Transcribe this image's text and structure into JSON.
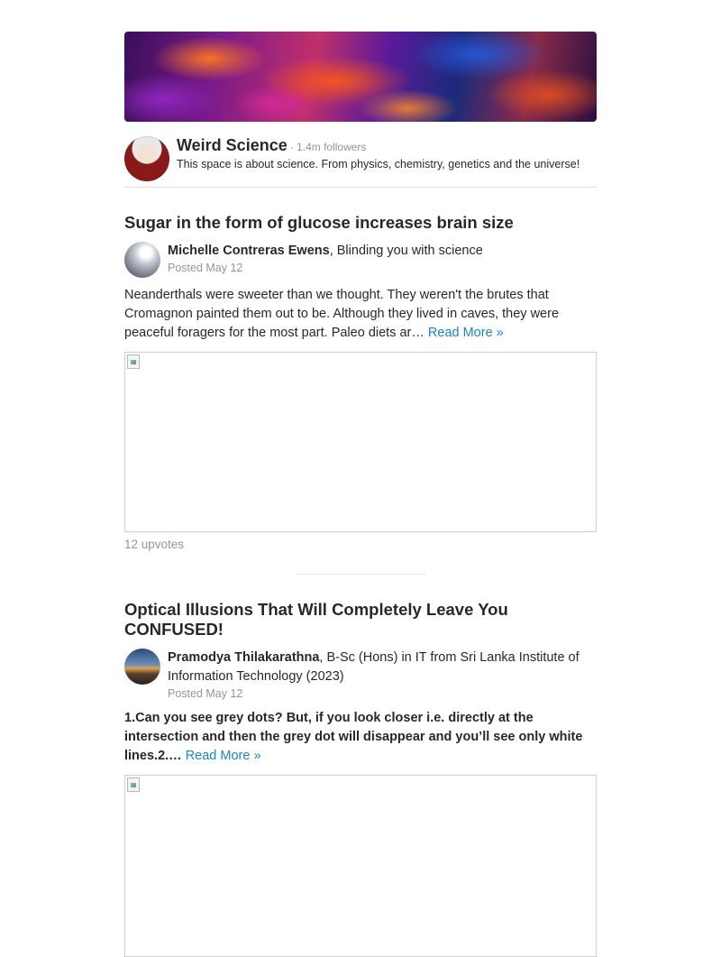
{
  "space": {
    "name": "Weird Science",
    "followers": "· 1.4m followers",
    "description": "This space is about science. From physics, chemistry, genetics and the universe!",
    "avatar_icon": "einstein-portrait-icon"
  },
  "posts": [
    {
      "title": "Sugar in the form of glucose increases brain size",
      "author_name": "Michelle Contreras Ewens",
      "author_credential": ", Blinding you with science",
      "posted": "Posted May 12",
      "text": "Neanderthals were sweeter than we thought. They weren't the brutes that Cromagnon painted them out to be. Although they lived in caves, they were peaceful foragers for the most part. Paleo diets ar… ",
      "read_more": "Read More »",
      "upvotes": "12 upvotes"
    },
    {
      "title": "Optical Illusions That Will Completely Leave You CONFUSED!",
      "author_name": "Pramodya Thilakarathna",
      "author_credential": ", B-Sc (Hons) in IT from Sri Lanka Institute of Information Technology (2023)",
      "posted": "Posted May 12",
      "text": "1.Can you see grey dots? But, if you look closer i.e. directly at the intersection and then the grey dot will disappear and you’ll see only white lines.2.… ",
      "read_more": "Read More »"
    }
  ],
  "colors": {
    "text": "#282829",
    "muted": "#939598",
    "link": "#1a84d6",
    "border": "#dedede"
  }
}
